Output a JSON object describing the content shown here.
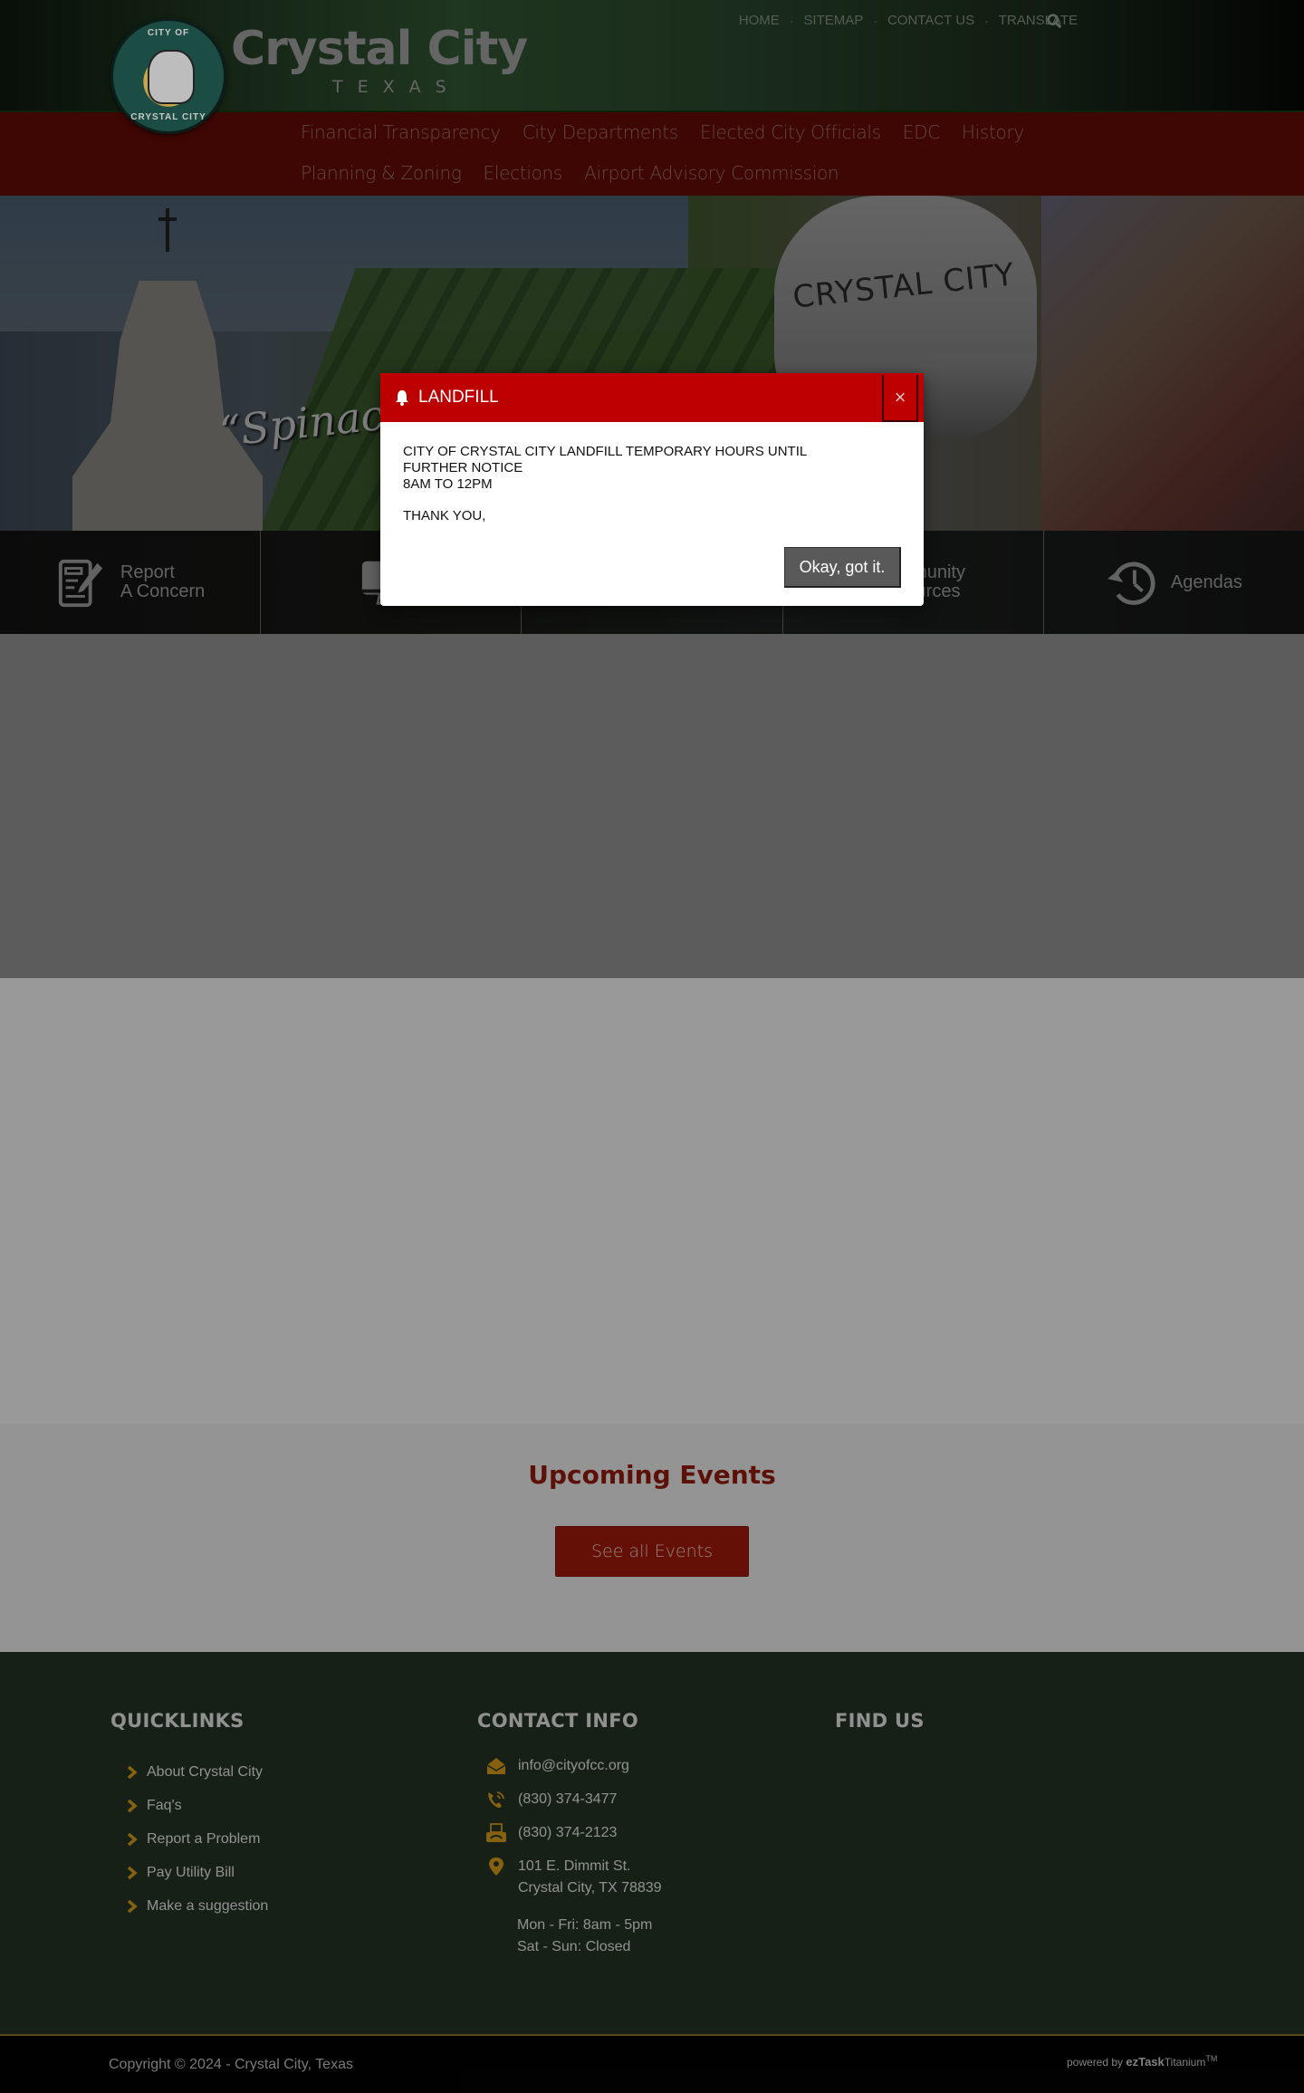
{
  "header": {
    "logo": {
      "seal_top": "CITY OF",
      "seal_bottom": "CRYSTAL CITY",
      "title": "Crystal City",
      "subtitle": "TEXAS"
    },
    "top_links": [
      {
        "label": "HOME"
      },
      {
        "label": "SITEMAP"
      },
      {
        "label": "CONTACT US"
      },
      {
        "label": "TRANSLATE"
      }
    ],
    "separator": "·",
    "search_icon": "search-icon"
  },
  "main_nav": {
    "items": [
      {
        "label": "Financial Transparency"
      },
      {
        "label": "City Departments"
      },
      {
        "label": "Elected City Officials"
      },
      {
        "label": "EDC"
      },
      {
        "label": "History"
      },
      {
        "label": "Planning & Zoning"
      },
      {
        "label": "Elections"
      },
      {
        "label": "Airport Advisory Commission"
      }
    ]
  },
  "hero": {
    "slogan": "“Spinach C",
    "tower_text": "CRYSTAL CITY"
  },
  "quick_bar": {
    "items": [
      {
        "icon": "report-concern-icon",
        "line1": "Report",
        "line2": "A Concern"
      },
      {
        "icon": "monitor-icon",
        "line1": "",
        "line2": ""
      },
      {
        "icon": "",
        "line1": "",
        "line2": ""
      },
      {
        "icon": "",
        "line1": "mmunity",
        "line2": "sources"
      },
      {
        "icon": "history-clock-icon",
        "line1": "Agendas",
        "line2": ""
      }
    ]
  },
  "events": {
    "title": "Upcoming Events",
    "button_label": "See all Events"
  },
  "footer": {
    "quicklinks": {
      "title": "QUICKLINKS",
      "items": [
        {
          "label": "About Crystal City"
        },
        {
          "label": "Faq's"
        },
        {
          "label": "Report a Problem"
        },
        {
          "label": "Pay Utility Bill"
        },
        {
          "label": "Make a suggestion"
        }
      ]
    },
    "contact": {
      "title": "CONTACT INFO",
      "email": "info@cityofcc.org",
      "phone": "(830) 374-3477",
      "fax": "(830) 374-2123",
      "address_line1": "101 E. Dimmit St.",
      "address_line2": "Crystal City, TX 78839",
      "hours_line1": "Mon - Fri: 8am - 5pm",
      "hours_line2": "Sat - Sun: Closed"
    },
    "find_us": {
      "title": "FIND US"
    },
    "accent_color": "#e0a21a"
  },
  "bottom_bar": {
    "copyright": "Copyright © 2024 - Crystal City, Texas",
    "powered_prefix": "powered by ",
    "powered_brand_bold": "ezTask",
    "powered_brand": "Titanium",
    "powered_tm": "TM"
  },
  "modal": {
    "title": "LANDFILL",
    "close_label": "×",
    "body_line1": "CITY OF CRYSTAL CITY LANDFILL TEMPORARY HOURS UNTIL",
    "body_line2": "FURTHER NOTICE",
    "body_line3": "8AM TO 12PM",
    "body_line4": "THANK YOU,",
    "ok_label": "Okay, got it.",
    "header_color": "#bd0000"
  },
  "colors": {
    "nav_red": "#6a0d05",
    "brand_red": "#a91c0b",
    "footer_green": "#263625"
  }
}
